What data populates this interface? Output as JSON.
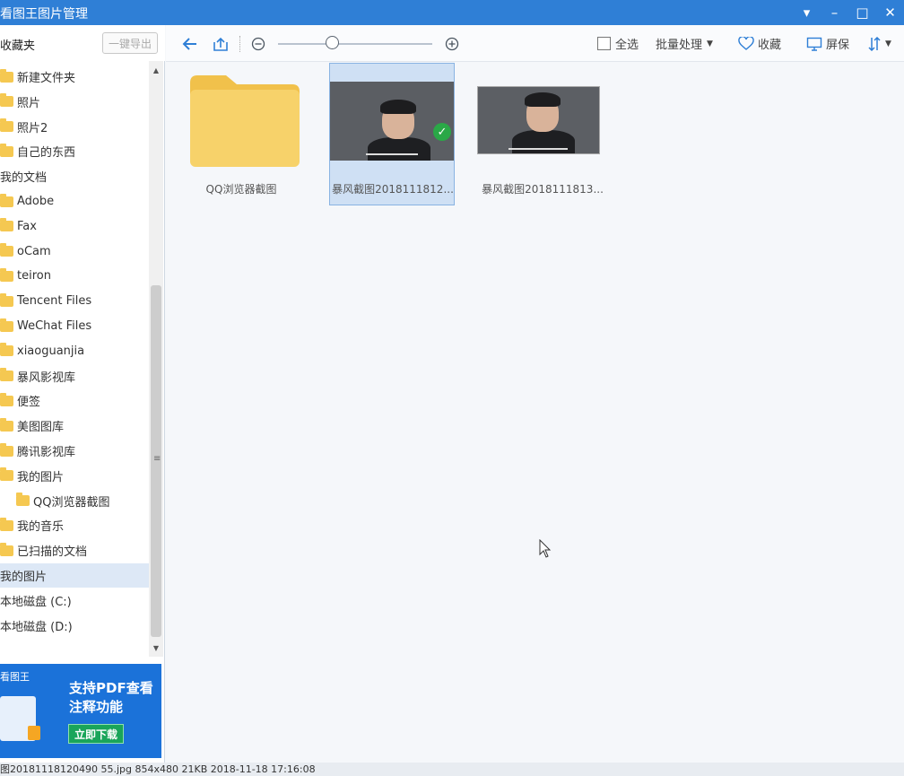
{
  "window": {
    "title": "看图王图片管理",
    "controls": [
      "▾",
      "–",
      "□",
      "✕"
    ]
  },
  "favorites": {
    "title": "收藏夹",
    "export_label": "一键导出"
  },
  "tree": [
    {
      "label": "新建文件夹",
      "folder": true,
      "indent": 0
    },
    {
      "label": "照片",
      "folder": true,
      "indent": 0
    },
    {
      "label": "照片2",
      "folder": true,
      "indent": 0
    },
    {
      "label": "自己的东西",
      "folder": true,
      "indent": 0
    },
    {
      "label": "我的文档",
      "folder": false,
      "indent": 0
    },
    {
      "label": "Adobe",
      "folder": true,
      "indent": 0
    },
    {
      "label": "Fax",
      "folder": true,
      "indent": 0
    },
    {
      "label": "oCam",
      "folder": true,
      "indent": 0
    },
    {
      "label": "teiron",
      "folder": true,
      "indent": 0
    },
    {
      "label": "Tencent Files",
      "folder": true,
      "indent": 0
    },
    {
      "label": "WeChat Files",
      "folder": true,
      "indent": 0
    },
    {
      "label": "xiaoguanjia",
      "folder": true,
      "indent": 0
    },
    {
      "label": "暴风影视库",
      "folder": true,
      "indent": 0
    },
    {
      "label": "便签",
      "folder": true,
      "indent": 0
    },
    {
      "label": "美图图库",
      "folder": true,
      "indent": 0
    },
    {
      "label": "腾讯影视库",
      "folder": true,
      "indent": 0
    },
    {
      "label": "我的图片",
      "folder": true,
      "indent": 0
    },
    {
      "label": "QQ浏览器截图",
      "folder": true,
      "indent": 1
    },
    {
      "label": "我的音乐",
      "folder": true,
      "indent": 0
    },
    {
      "label": "已扫描的文档",
      "folder": true,
      "indent": 0
    },
    {
      "label": "我的图片",
      "folder": false,
      "indent": 0,
      "selected": true
    },
    {
      "label": "本地磁盘 (C:)",
      "folder": false,
      "indent": 0
    },
    {
      "label": "本地磁盘 (D:)",
      "folder": false,
      "indent": 0
    }
  ],
  "ad": {
    "brand": "看图王",
    "line1": "支持PDF查看",
    "line2": "注释功能",
    "button": "立即下载"
  },
  "toolbar": {
    "select_all": "全选",
    "batch": "批量处理",
    "favorite": "收藏",
    "screen": "屏保",
    "zoom_level": 0.35
  },
  "items": [
    {
      "type": "folder",
      "label": "QQ浏览器截图"
    },
    {
      "type": "image",
      "label": "暴风截图2018111812...",
      "selected": true
    },
    {
      "type": "image",
      "label": "暴风截图2018111813..."
    }
  ],
  "status": {
    "text": "图20181118120490 55.jpg   854x480   21KB   2018-11-18 17:16:08"
  },
  "colors": {
    "titlebar": "#2f7fd6",
    "folder": "#f5c851",
    "ad_bg": "#1b72d9",
    "ad_button": "#1aa55a",
    "selection": "#cfe0f4",
    "check": "#2aa847"
  }
}
